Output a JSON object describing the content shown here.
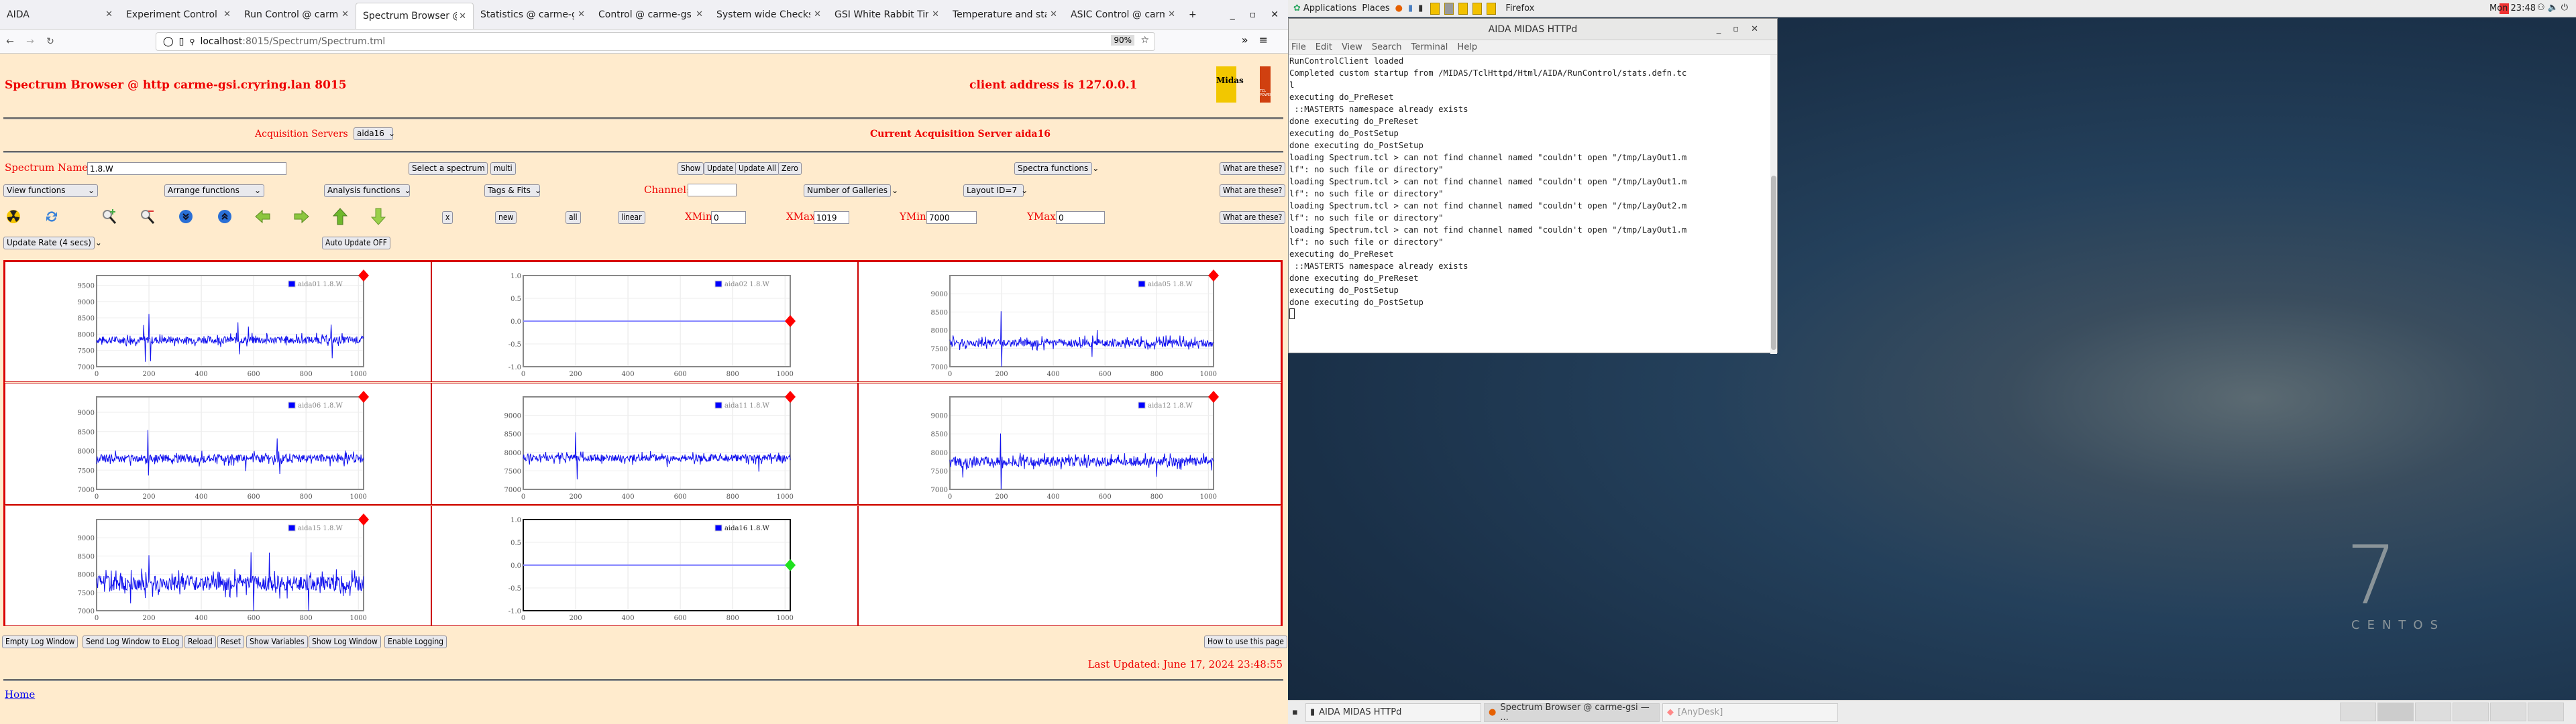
{
  "browser": {
    "tabs": [
      {
        "label": "AIDA",
        "active": false
      },
      {
        "label": "Experiment Control @",
        "active": false
      },
      {
        "label": "Run Control @ carme",
        "active": false
      },
      {
        "label": "Spectrum Browser @",
        "active": true
      },
      {
        "label": "Statistics @ carme-g",
        "active": false
      },
      {
        "label": "Control @ carme-gsi",
        "active": false
      },
      {
        "label": "System wide Checks",
        "active": false
      },
      {
        "label": "GSI White Rabbit Tim",
        "active": false
      },
      {
        "label": "Temperature and stat",
        "active": false
      },
      {
        "label": "ASIC Control @ carm",
        "active": false
      }
    ],
    "new_tab": "+",
    "url_host": "localhost",
    "url_path": ":8015/Spectrum/Spectrum.tml",
    "zoom": "90%"
  },
  "page": {
    "title": "Spectrum Browser @ http carme-gsi.cryring.lan 8015",
    "client_address": "client address is 127.0.0.1",
    "logo_midas": "Midas",
    "logo_tcl": "TCL POWERED",
    "acq_label": "Acquisition Servers",
    "acq_value": "aida16",
    "current_server": "Current Acquisition Server aida16",
    "spectrum_name_label": "Spectrum Name:",
    "spectrum_name_value": "1.8.W",
    "select_spectrum": "Select a spectrum",
    "multi": "multi",
    "show": "Show",
    "update": "Update",
    "update_all": "Update All",
    "zero": "Zero",
    "spectra_functions": "Spectra functions",
    "what": "What are these?",
    "view_functions": "View functions",
    "arrange_functions": "Arrange functions",
    "analysis_functions": "Analysis functions",
    "tags_fits": "Tags & Fits",
    "channel_label": "Channel:",
    "channel_value": "",
    "num_galleries": "Number of Galleries",
    "layout_id": "Layout ID=7",
    "x_btn": "x",
    "new_btn": "new",
    "all_btn": "all",
    "linear_btn": "linear",
    "xmin_label": "XMin",
    "xmin": "0",
    "xmax_label": "XMax",
    "xmax": "1019",
    "ymin_label": "YMin",
    "ymin": "7000",
    "ymax_label": "YMax",
    "ymax": "0",
    "update_rate": "Update Rate (4 secs)",
    "auto_update": "Auto Update OFF",
    "footer_buttons": [
      "Empty Log Window",
      "Send Log Window to ELog",
      "Reload",
      "Reset",
      "Show Variables",
      "Show Log Window",
      "Enable Logging"
    ],
    "how_to": "How to use this page",
    "last_updated": "Last Updated: June 17, 2024 23:48:55",
    "home": "Home"
  },
  "chart_data": [
    {
      "type": "line",
      "legend": "aida01 1.8.W",
      "xlim": [
        0,
        1020
      ],
      "ylim": [
        7000,
        9800
      ],
      "yticks": [
        7000,
        7500,
        8000,
        8500,
        9000,
        9500
      ],
      "xticks": [
        0,
        200,
        400,
        600,
        800,
        1000
      ],
      "baseline": 7820,
      "noise": 140,
      "spikes": [
        [
          180,
          8280
        ],
        [
          185,
          7150
        ],
        [
          200,
          8620
        ],
        [
          205,
          7170
        ],
        [
          540,
          8360
        ],
        [
          545,
          7380
        ],
        [
          580,
          8230
        ],
        [
          895,
          8290
        ],
        [
          900,
          7260
        ]
      ],
      "marker": "red",
      "status": "active"
    },
    {
      "type": "line",
      "legend": "aida02 1.8.W",
      "xlim": [
        0,
        1020
      ],
      "ylim": [
        -1,
        1
      ],
      "yticks": [
        -1.0,
        -0.5,
        0.0,
        0.5,
        1.0
      ],
      "xticks": [
        0,
        200,
        400,
        600,
        800,
        1000
      ],
      "baseline": 0,
      "noise": 0,
      "spikes": [],
      "marker": "red",
      "status": "empty"
    },
    {
      "type": "line",
      "legend": "aida05 1.8.W",
      "xlim": [
        0,
        1020
      ],
      "ylim": [
        7000,
        9500
      ],
      "yticks": [
        7000,
        7500,
        8000,
        8500,
        9000
      ],
      "xticks": [
        0,
        200,
        400,
        600,
        800,
        1000
      ],
      "baseline": 7650,
      "noise": 130,
      "spikes": [
        [
          198,
          8520
        ],
        [
          200,
          7000
        ],
        [
          550,
          7270
        ],
        [
          570,
          8010
        ]
      ],
      "marker": "red",
      "status": "active"
    },
    {
      "type": "line",
      "legend": "aida06 1.8.W",
      "xlim": [
        0,
        1020
      ],
      "ylim": [
        7000,
        9400
      ],
      "yticks": [
        7000,
        7500,
        8000,
        8500,
        9000
      ],
      "xticks": [
        0,
        200,
        400,
        600,
        800,
        1000
      ],
      "baseline": 7800,
      "noise": 130,
      "spikes": [
        [
          195,
          8540
        ],
        [
          198,
          7360
        ],
        [
          690,
          8320
        ],
        [
          700,
          7400
        ],
        [
          570,
          7470
        ]
      ],
      "marker": "red",
      "status": "active"
    },
    {
      "type": "line",
      "legend": "aida11 1.8.W",
      "xlim": [
        0,
        1020
      ],
      "ylim": [
        7000,
        9500
      ],
      "yticks": [
        7000,
        7500,
        8000,
        8500,
        9000
      ],
      "xticks": [
        0,
        200,
        400,
        600,
        800,
        1000
      ],
      "baseline": 7850,
      "noise": 120,
      "spikes": [
        [
          200,
          8540
        ],
        [
          205,
          7270
        ],
        [
          900,
          7480
        ],
        [
          550,
          7600
        ]
      ],
      "marker": "red",
      "status": "active"
    },
    {
      "type": "line",
      "legend": "aida12 1.8.W",
      "xlim": [
        0,
        1020
      ],
      "ylim": [
        7000,
        9500
      ],
      "yticks": [
        7000,
        7500,
        8000,
        8500,
        9000
      ],
      "xticks": [
        0,
        200,
        400,
        600,
        800,
        1000
      ],
      "baseline": 7750,
      "noise": 150,
      "spikes": [
        [
          195,
          8510
        ],
        [
          198,
          7000
        ],
        [
          800,
          7340
        ],
        [
          50,
          7320
        ]
      ],
      "marker": "red",
      "status": "active"
    },
    {
      "type": "line",
      "legend": "aida15 1.8.W",
      "xlim": [
        0,
        1020
      ],
      "ylim": [
        7000,
        9500
      ],
      "yticks": [
        7000,
        7500,
        8000,
        8500,
        9000
      ],
      "xticks": [
        0,
        200,
        400,
        600,
        800,
        1000
      ],
      "baseline": 7750,
      "noise": 260,
      "spikes": [
        [
          200,
          8520
        ],
        [
          590,
          8600
        ],
        [
          600,
          7000
        ],
        [
          660,
          8590
        ],
        [
          810,
          7000
        ],
        [
          130,
          7200
        ]
      ],
      "marker": "red",
      "status": "active"
    },
    {
      "type": "line",
      "legend": "aida16 1.8.W",
      "xlim": [
        0,
        1020
      ],
      "ylim": [
        -1,
        1
      ],
      "yticks": [
        -1.0,
        -0.5,
        0.0,
        0.5,
        1.0
      ],
      "xticks": [
        0,
        200,
        400,
        600,
        800,
        1000
      ],
      "baseline": 0,
      "noise": 0,
      "spikes": [],
      "marker": "green",
      "status": "selected"
    }
  ],
  "desktop": {
    "applications": "Applications",
    "places": "Places",
    "firefox": "Firefox",
    "clock": "Mon 23:48",
    "centos_version": "7",
    "centos": "CENTOS"
  },
  "terminal": {
    "title": "AIDA MIDAS HTTPd",
    "menu": [
      "File",
      "Edit",
      "View",
      "Search",
      "Terminal",
      "Help"
    ],
    "lines": [
      "RunControlClient loaded",
      "Completed custom startup from /MIDAS/TclHttpd/Html/AIDA/RunControl/stats.defn.tc",
      "l",
      "executing do_PreReset",
      " ::MASTERTS namespace already exists",
      "done executing do_PreReset",
      "executing do_PostSetup",
      "done executing do_PostSetup",
      "loading Spectrum.tcl > can not find channel named \"couldn't open \"/tmp/LayOut1.m",
      "lf\": no such file or directory\"",
      "loading Spectrum.tcl > can not find channel named \"couldn't open \"/tmp/LayOut1.m",
      "lf\": no such file or directory\"",
      "loading Spectrum.tcl > can not find channel named \"couldn't open \"/tmp/LayOut2.m",
      "lf\": no such file or directory\"",
      "loading Spectrum.tcl > can not find channel named \"couldn't open \"/tmp/LayOut1.m",
      "lf\": no such file or directory\"",
      "executing do_PreReset",
      " ::MASTERTS namespace already exists",
      "done executing do_PreReset",
      "executing do_PostSetup",
      "done executing do_PostSetup"
    ]
  },
  "taskbar": {
    "items": [
      {
        "label": "AIDA MIDAS HTTPd",
        "active": false
      },
      {
        "label": "Spectrum Browser @ carme-gsi — ...",
        "active": true
      },
      {
        "label": "[AnyDesk]",
        "active": false
      }
    ]
  }
}
